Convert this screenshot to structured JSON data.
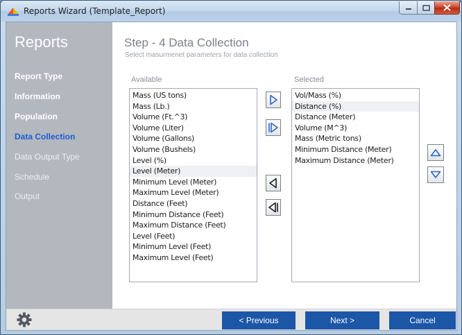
{
  "window": {
    "title": "Reports Wizard (Template_Report)"
  },
  "sidebar": {
    "title": "Reports",
    "items": [
      {
        "label": "Report Type",
        "state": "done"
      },
      {
        "label": "Information",
        "state": "done"
      },
      {
        "label": "Population",
        "state": "done"
      },
      {
        "label": "Data Collection",
        "state": "active"
      },
      {
        "label": "Data Output Type",
        "state": "pending"
      },
      {
        "label": "Schedule",
        "state": "pending"
      },
      {
        "label": "Output",
        "state": "pending"
      }
    ]
  },
  "step": {
    "title": "Step - 4   Data Collection",
    "subtitle": "Select masurmenet parameters for data collection"
  },
  "available": {
    "label": "Available",
    "items": [
      "Mass (US tons)",
      "Mass (Lb.)",
      "Volume (Ft.^3)",
      "Volume (Liter)",
      "Volume (Gallons)",
      "Volume (Bushels)",
      "Level (%)",
      "Level (Meter)",
      "Minimum Level (Meter)",
      "Maximum Level (Meter)",
      "Distance (Feet)",
      "Minimum Distance (Feet)",
      "Maximum Distance (Feet)",
      "Level (Feet)",
      "Minimum Level (Feet)",
      "Maximum Level (Feet)"
    ],
    "highlighted_index": 7
  },
  "selected": {
    "label": "Selected",
    "items": [
      "Vol/Mass (%)",
      "Distance (%)",
      "Distance (Meter)",
      "Volume (M^3)",
      "Mass (Metric tons)",
      "Minimum Distance (Meter)",
      "Maximum Distance (Meter)"
    ],
    "highlighted_index": 1
  },
  "transfer_buttons": {
    "add": "play-right-icon",
    "add_all": "double-play-right-icon",
    "remove": "play-left-icon",
    "remove_all": "double-play-left-icon",
    "move_up": "triangle-up-icon",
    "move_down": "triangle-down-icon"
  },
  "footer": {
    "settings_icon": "gear-icon",
    "previous_label": "< Previous",
    "next_label": "Next >",
    "cancel_label": "Cancel"
  },
  "colors": {
    "sidebar_bg": "#b3b8bf",
    "active_nav": "#1d5bd6",
    "button_blue": "#1c56a7",
    "footer_bg": "#e5e5e5"
  }
}
